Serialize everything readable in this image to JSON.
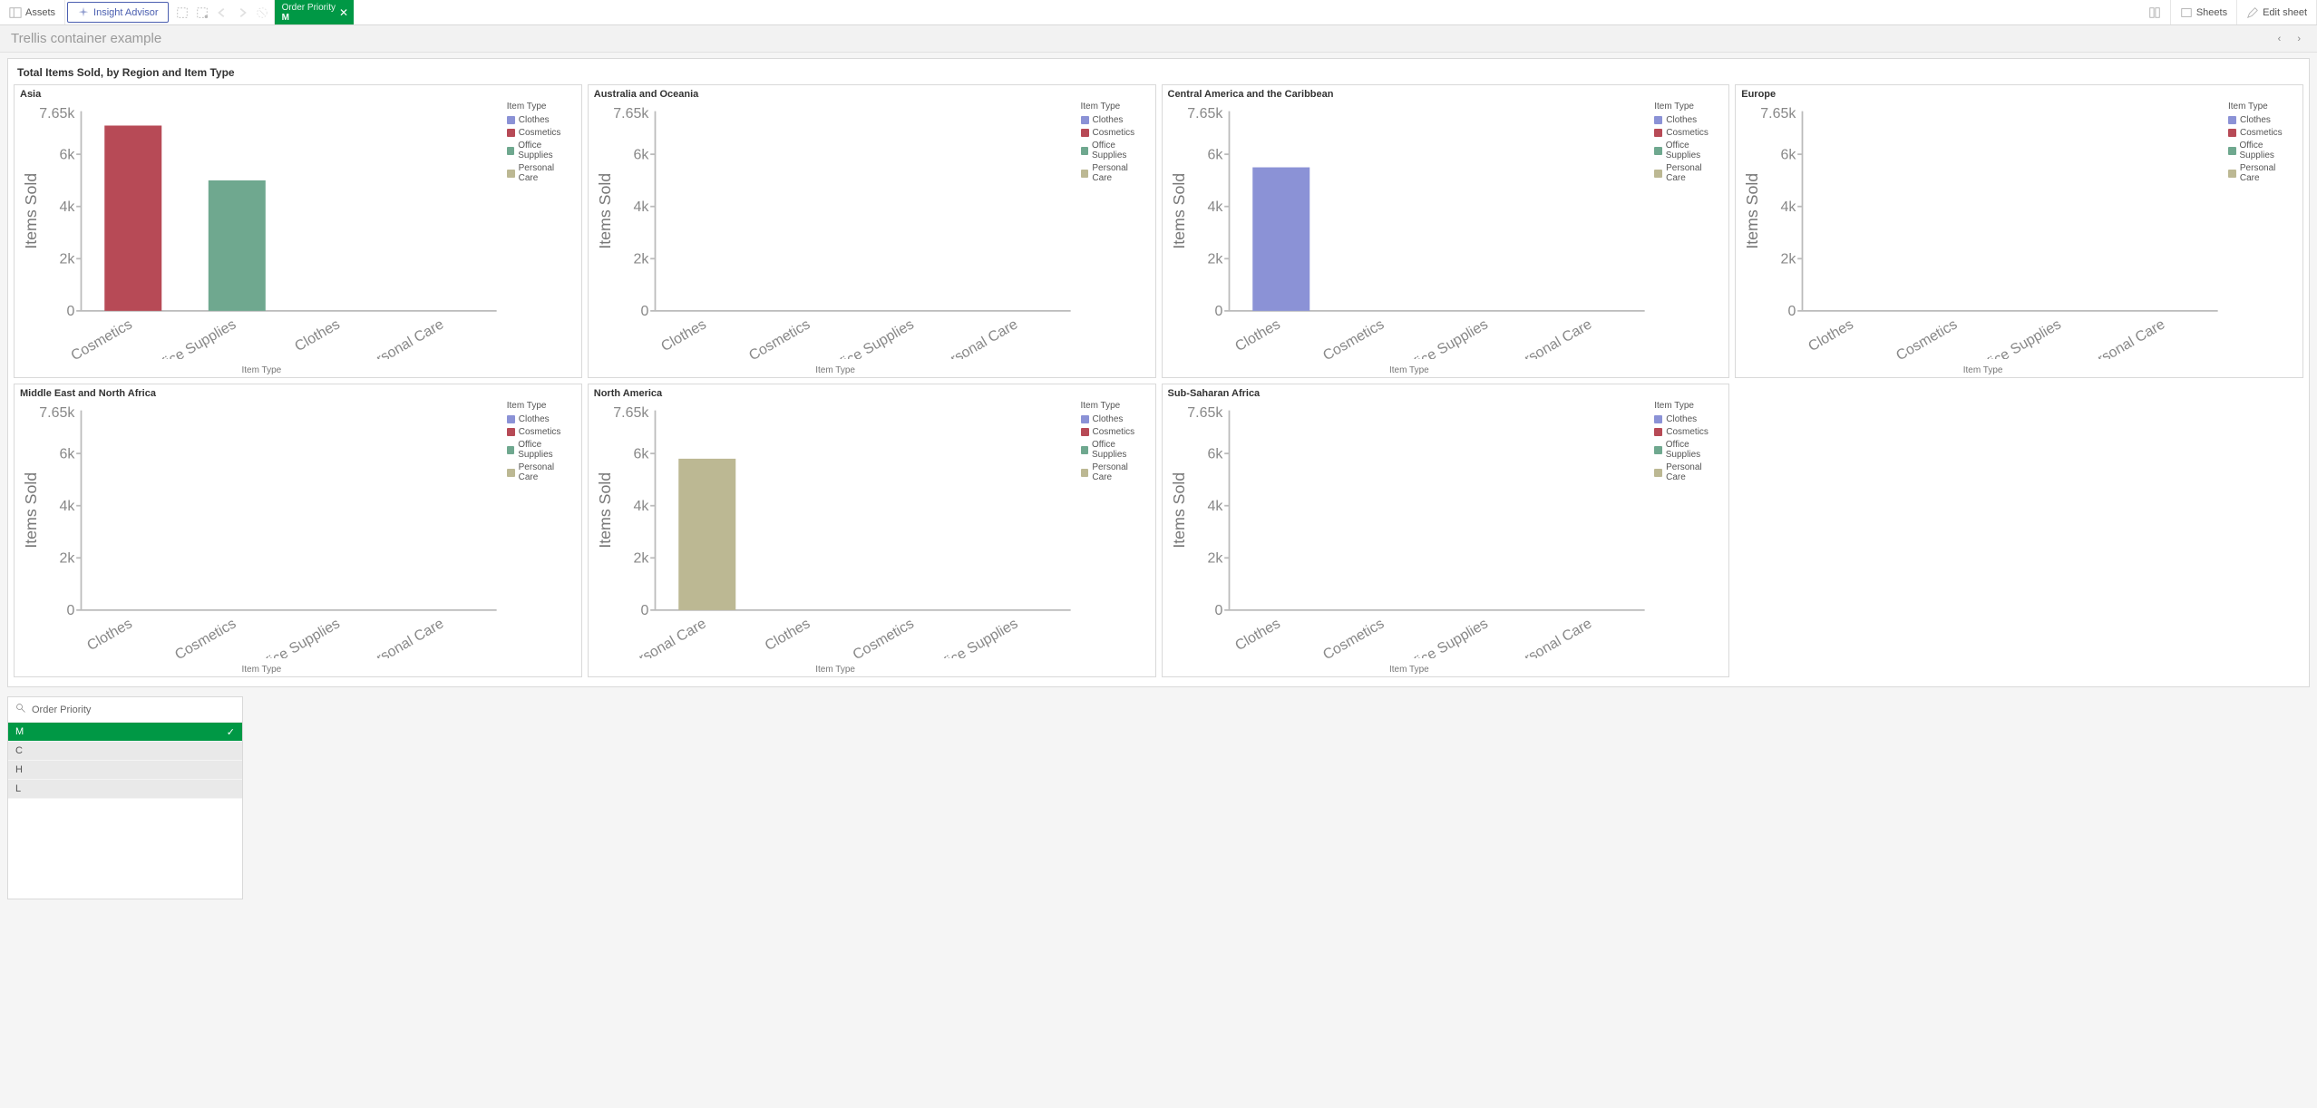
{
  "toolbar": {
    "assets": "Assets",
    "insight": "Insight Advisor",
    "sheets": "Sheets",
    "edit": "Edit sheet",
    "filter_dimension": "Order Priority",
    "filter_value": "M"
  },
  "sheet": {
    "title": "Trellis container example"
  },
  "trellis": {
    "title": "Total Items Sold, by Region and Item Type",
    "ylabel": "Items Sold",
    "xlabel": "Item Type",
    "legend_title": "Item Type",
    "ymax_label": "7.65k",
    "legend_items": [
      {
        "name": "Clothes",
        "color": "#8b92d6"
      },
      {
        "name": "Cosmetics",
        "color": "#b74a56"
      },
      {
        "name": "Office Supplies",
        "color": "#6fa88f"
      },
      {
        "name": "Personal Care",
        "color": "#bcb893"
      }
    ]
  },
  "chart_data": [
    {
      "title": "Asia",
      "type": "bar",
      "ylabel": "Items Sold",
      "xlabel": "Item Type",
      "ylim": [
        0,
        7650
      ],
      "categories": [
        "Cosmetics",
        "Office Supplies",
        "Clothes",
        "Personal Care"
      ],
      "values": [
        7100,
        5000,
        0,
        0
      ],
      "colors": [
        "#b74a56",
        "#6fa88f",
        "#8b92d6",
        "#bcb893"
      ]
    },
    {
      "title": "Australia and Oceania",
      "type": "bar",
      "ylabel": "Items Sold",
      "xlabel": "Item Type",
      "ylim": [
        0,
        7650
      ],
      "categories": [
        "Clothes",
        "Cosmetics",
        "Office Supplies",
        "Personal Care"
      ],
      "values": [
        0,
        0,
        0,
        0
      ],
      "colors": [
        "#8b92d6",
        "#b74a56",
        "#6fa88f",
        "#bcb893"
      ]
    },
    {
      "title": "Central America and the Caribbean",
      "type": "bar",
      "ylabel": "Items Sold",
      "xlabel": "Item Type",
      "ylim": [
        0,
        7650
      ],
      "categories": [
        "Clothes",
        "Cosmetics",
        "Office Supplies",
        "Personal Care"
      ],
      "values": [
        5500,
        0,
        0,
        0
      ],
      "colors": [
        "#8b92d6",
        "#b74a56",
        "#6fa88f",
        "#bcb893"
      ]
    },
    {
      "title": "Europe",
      "type": "bar",
      "ylabel": "Items Sold",
      "xlabel": "Item Type",
      "ylim": [
        0,
        7650
      ],
      "categories": [
        "Clothes",
        "Cosmetics",
        "Office Supplies",
        "Personal Care"
      ],
      "values": [
        0,
        0,
        0,
        0
      ],
      "colors": [
        "#8b92d6",
        "#b74a56",
        "#6fa88f",
        "#bcb893"
      ]
    },
    {
      "title": "Middle East and North Africa",
      "type": "bar",
      "ylabel": "Items Sold",
      "xlabel": "Item Type",
      "ylim": [
        0,
        7650
      ],
      "categories": [
        "Clothes",
        "Cosmetics",
        "Office Supplies",
        "Personal Care"
      ],
      "values": [
        0,
        0,
        0,
        0
      ],
      "colors": [
        "#8b92d6",
        "#b74a56",
        "#6fa88f",
        "#bcb893"
      ]
    },
    {
      "title": "North America",
      "type": "bar",
      "ylabel": "Items Sold",
      "xlabel": "Item Type",
      "ylim": [
        0,
        7650
      ],
      "categories": [
        "Personal Care",
        "Clothes",
        "Cosmetics",
        "Office Supplies"
      ],
      "values": [
        5800,
        0,
        0,
        0
      ],
      "colors": [
        "#bcb893",
        "#8b92d6",
        "#b74a56",
        "#6fa88f"
      ]
    },
    {
      "title": "Sub-Saharan Africa",
      "type": "bar",
      "ylabel": "Items Sold",
      "xlabel": "Item Type",
      "ylim": [
        0,
        7650
      ],
      "categories": [
        "Clothes",
        "Cosmetics",
        "Office Supplies",
        "Personal Care"
      ],
      "values": [
        0,
        0,
        0,
        0
      ],
      "colors": [
        "#8b92d6",
        "#b74a56",
        "#6fa88f",
        "#bcb893"
      ]
    }
  ],
  "filter": {
    "label": "Order Priority",
    "options": [
      {
        "label": "M",
        "selected": true
      },
      {
        "label": "C",
        "selected": false
      },
      {
        "label": "H",
        "selected": false
      },
      {
        "label": "L",
        "selected": false
      }
    ]
  }
}
